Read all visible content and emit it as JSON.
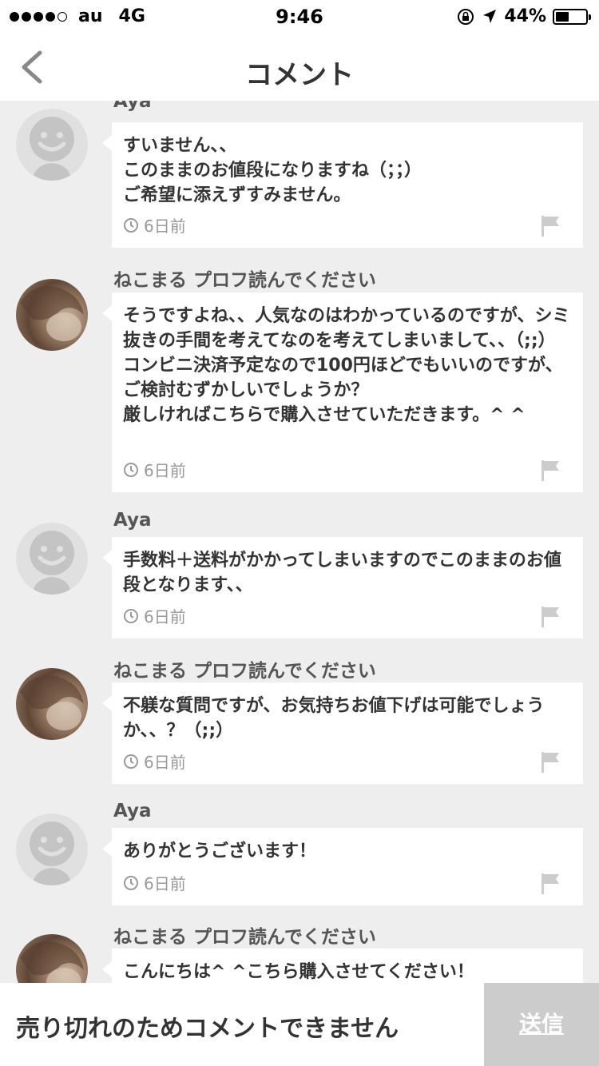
{
  "status_bar": {
    "carrier": "au",
    "network": "4G",
    "time": "9:46",
    "battery_percent_text": "44%",
    "battery_level": 0.44
  },
  "header": {
    "title": "コメント"
  },
  "comments": [
    {
      "user": "Aya",
      "avatar": "default-avatar-icon",
      "text": "すいません、、\nこのままのお値段になりますね（；；）\nご希望に添えずすみません。",
      "time": "6日前"
    },
    {
      "user": "ねこまる プロフ読んでください",
      "avatar": "user-photo",
      "text": "そうですよね、、人気なのはわかっているのですが、シミ抜きの手間を考えてなのを考えてしまいまして、、（;;）コンビニ決済予定なので100円ほどでもいいのですが、ご検討むずかしいでしょうか？\n厳しければこちらで購入させていただきます。^ ^",
      "time": "6日前"
    },
    {
      "user": "Aya",
      "avatar": "default-avatar-icon",
      "text": "手数料＋送料がかかってしまいますのでこのままのお値段となります、、",
      "time": "6日前"
    },
    {
      "user": "ねこまる プロフ読んでください",
      "avatar": "user-photo",
      "text": "不躾な質問ですが、お気持ちお値下げは可能でしょうか、、？（;;）",
      "time": "6日前"
    },
    {
      "user": "Aya",
      "avatar": "default-avatar-icon",
      "text": "ありがとうございます！",
      "time": "6日前"
    },
    {
      "user": "ねこまる プロフ読んでください",
      "avatar": "user-photo",
      "text": "こんにちは^ ^こちら購入させてください！",
      "time": ""
    }
  ],
  "footer": {
    "notice": "売り切れのためコメントできません",
    "send_label": "送信"
  },
  "colors": {
    "background": "#eeeeee",
    "bubble": "#ffffff",
    "disabled_button": "#cccccc",
    "meta_text": "#999999"
  }
}
